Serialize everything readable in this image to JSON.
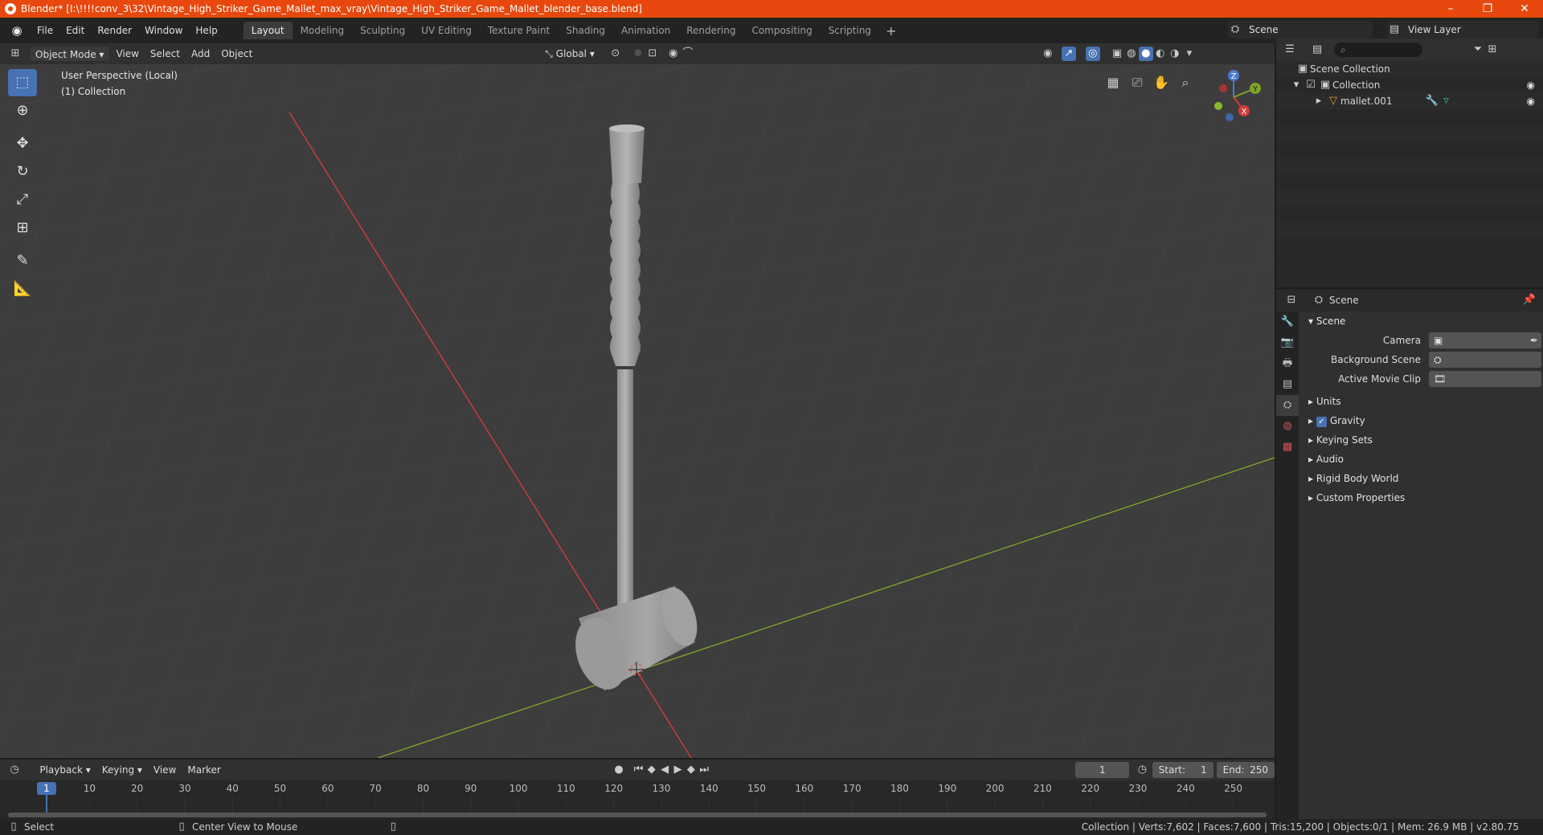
{
  "window": {
    "title": "Blender* [I:\\!!!!conv_3\\32\\Vintage_High_Striker_Game_Mallet_max_vray\\Vintage_High_Striker_Game_Mallet_blender_base.blend]",
    "minimize": "–",
    "maximize": "❐",
    "close": "✕"
  },
  "menu": {
    "items": [
      "File",
      "Edit",
      "Render",
      "Window",
      "Help"
    ]
  },
  "workspaces": {
    "tabs": [
      "Layout",
      "Modeling",
      "Sculpting",
      "UV Editing",
      "Texture Paint",
      "Shading",
      "Animation",
      "Rendering",
      "Compositing",
      "Scripting"
    ],
    "active": "Layout",
    "add": "+"
  },
  "scene_selector": {
    "value": "Scene"
  },
  "view_layer_selector": {
    "value": "View Layer"
  },
  "viewport_header": {
    "mode": "Object Mode",
    "menus": [
      "View",
      "Select",
      "Add",
      "Object"
    ],
    "orientation": "Global"
  },
  "viewport": {
    "perspective": "User Perspective (Local)",
    "collection": "(1) Collection",
    "gizmo": {
      "z": "Z",
      "y": "Y",
      "x": "X"
    },
    "x_axis_color": "#d23b3b",
    "y_axis_color": "#7fa32a"
  },
  "outliner": {
    "rows": [
      {
        "label": "Scene Collection"
      },
      {
        "label": "Collection"
      },
      {
        "label": "mallet.001"
      }
    ]
  },
  "properties": {
    "context": "Scene",
    "panel": "Scene",
    "fields": [
      {
        "label": "Camera",
        "value": ""
      },
      {
        "label": "Background Scene",
        "value": ""
      },
      {
        "label": "Active Movie Clip",
        "value": ""
      }
    ],
    "subpanels": [
      "Units",
      "Gravity",
      "Keying Sets",
      "Audio",
      "Rigid Body World",
      "Custom Properties"
    ]
  },
  "timeline": {
    "menus": [
      "Playback",
      "Keying",
      "View",
      "Marker"
    ],
    "current_frame": "1",
    "start_label": "Start:",
    "start": "1",
    "end_label": "End:",
    "end": "250",
    "ruler": [
      "1",
      "10",
      "20",
      "30",
      "40",
      "50",
      "60",
      "70",
      "80",
      "90",
      "100",
      "110",
      "120",
      "130",
      "140",
      "150",
      "160",
      "170",
      "180",
      "190",
      "200",
      "210",
      "220",
      "230",
      "240",
      "250"
    ]
  },
  "statusbar": {
    "left": "Select",
    "middle": "Center View to Mouse",
    "right": "Collection | Verts:7,602 | Faces:7,600 | Tris:15,200 | Objects:0/1 | Mem: 26.9 MB | v2.80.75"
  }
}
